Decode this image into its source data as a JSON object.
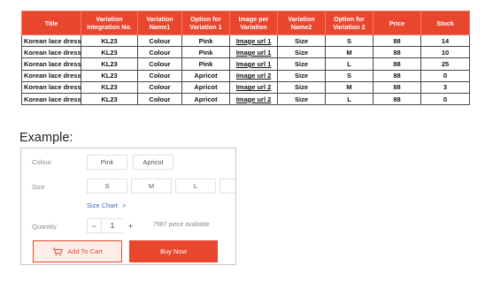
{
  "table": {
    "headers": [
      "Title",
      "Variation integration No.",
      "Variation Name1",
      "Option for Variation 1",
      "Image per Variation",
      "Variation Name2",
      "Option for Variation 2",
      "Price",
      "Stock"
    ],
    "rows": [
      [
        "Korean lace dress",
        "KL23",
        "Colour",
        "Pink",
        "Image url 1",
        "Size",
        "S",
        "88",
        "14"
      ],
      [
        "Korean lace dress",
        "KL23",
        "Colour",
        "Pink",
        "Image url 1",
        "Size",
        "M",
        "88",
        "10"
      ],
      [
        "Korean lace dress",
        "KL23",
        "Colour",
        "Pink",
        "Image url 1",
        "Size",
        "L",
        "88",
        "25"
      ],
      [
        "Korean lace dress",
        "KL23",
        "Colour",
        "Apricot",
        "Image url 2",
        "Size",
        "S",
        "88",
        "0"
      ],
      [
        "Korean lace dress",
        "KL23",
        "Colour",
        "Apricot",
        "Image url 2",
        "Size",
        "M",
        "88",
        "3"
      ],
      [
        "Korean lace dress",
        "KL23",
        "Colour",
        "Apricot",
        "Image url 2",
        "Size",
        "L",
        "88",
        "0"
      ]
    ]
  },
  "example": {
    "label": "Example:",
    "colour_label": "Colour",
    "colour_options": [
      "Pink",
      "Apricot"
    ],
    "size_label": "Size",
    "size_options": [
      "S",
      "M",
      "L"
    ],
    "size_chart_label": "Size Chart",
    "size_chart_arrow": ">",
    "quantity_label": "Quantity",
    "qty_minus": "−",
    "qty_value": "1",
    "qty_plus": "+",
    "available_text": "7987 piece available",
    "add_to_cart_label": "Add To Cart",
    "buy_now_label": "Buy Now"
  },
  "colors": {
    "accent": "#e8472d",
    "link": "#3b6ec4"
  },
  "icons": {
    "cart": "cart-icon"
  }
}
